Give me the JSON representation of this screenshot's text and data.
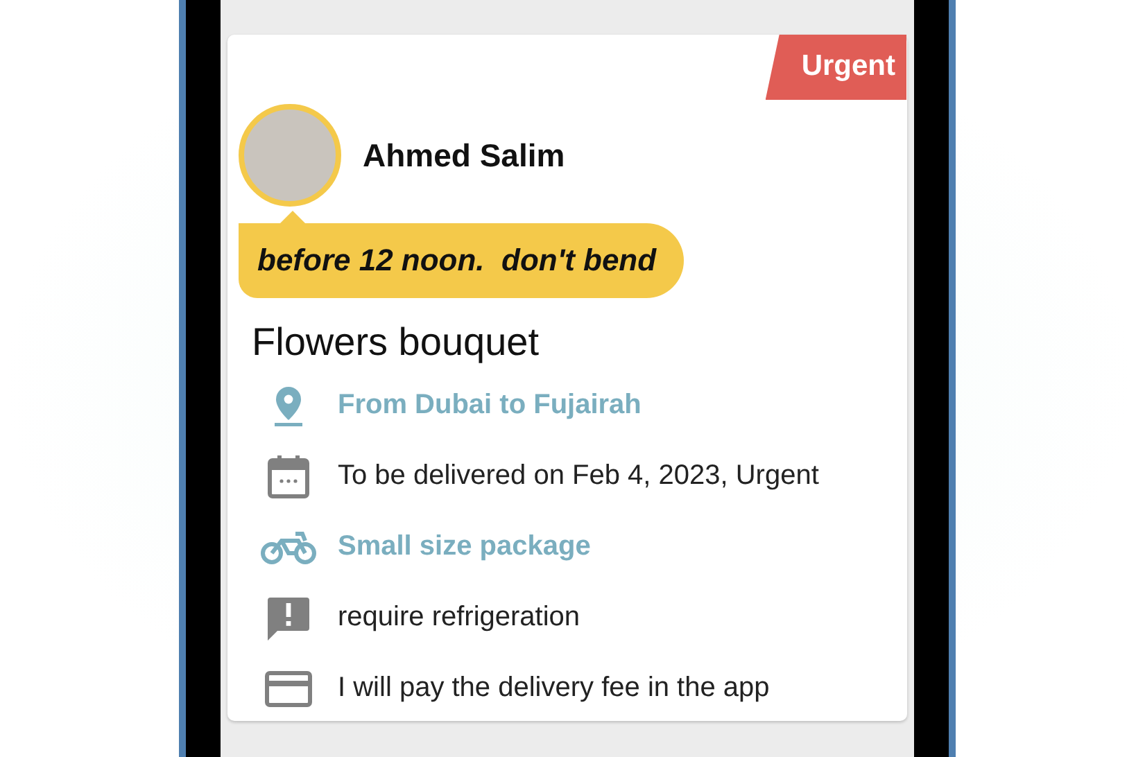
{
  "order": {
    "badge": "Urgent",
    "sender": {
      "name": "Ahmed Salim"
    },
    "note": "before 12 noon.  don't bend",
    "title": "Flowers bouquet",
    "details": [
      {
        "kind": "pin",
        "text": "From Dubai to Fujairah",
        "highlighted": true
      },
      {
        "kind": "calendar",
        "text": "To be delivered on Feb 4, 2023, Urgent",
        "highlighted": false
      },
      {
        "kind": "bike",
        "text": "Small size package",
        "highlighted": true
      },
      {
        "kind": "alert",
        "text": "require refrigeration",
        "highlighted": false
      },
      {
        "kind": "card",
        "text": "I will pay the delivery fee in the app",
        "highlighted": false
      }
    ]
  }
}
